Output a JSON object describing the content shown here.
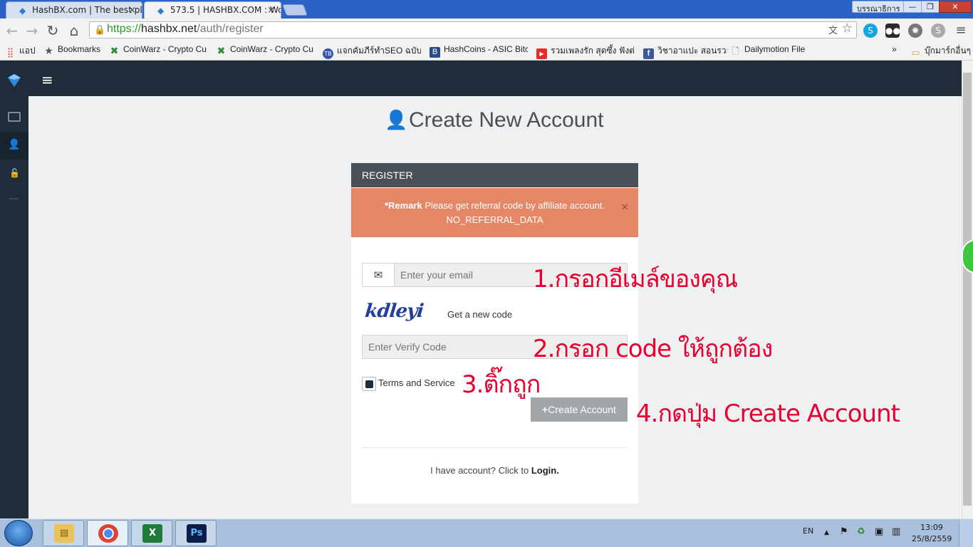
{
  "browser": {
    "tabs": [
      {
        "title": "HashBX.com | The best pl",
        "close": "×"
      },
      {
        "title": "573.5 | HASHBX.COM : Wo",
        "close": "×"
      }
    ],
    "profile_label": "บรรณาธิการ",
    "window_controls": {
      "minimize": "—",
      "restore": "❐",
      "close": "✕"
    },
    "url": {
      "scheme": "https://",
      "host": "hashbx.net",
      "path": "/auth/register"
    },
    "nav": {
      "back": "←",
      "forward": "→",
      "reload": "↻",
      "home": "⌂"
    },
    "star": "☆",
    "menu": "≡"
  },
  "bookmarks": {
    "items": [
      {
        "label": "แอป",
        "icon": "apps-grid-icon",
        "color": "#e04b3a"
      },
      {
        "label": "Bookmarks",
        "icon": "star-icon",
        "color": "#555555"
      },
      {
        "label": "CoinWarz - Crypto Cu",
        "icon": "coinwarz-icon",
        "color": "#2e8b3a"
      },
      {
        "label": "CoinWarz - Crypto Cu",
        "icon": "coinwarz-icon",
        "color": "#2e8b3a"
      },
      {
        "label": "แจกคัมภีร์ทำSEO ฉบับเต็",
        "icon": "seo-icon",
        "color": "#3657a8"
      },
      {
        "label": "HashCoins - ASIC Bitc",
        "icon": "hashcoins-icon",
        "color": "#2c4a85"
      },
      {
        "label": "รวมเพลงรัก สุดซึ้ง ฟังต่อเ",
        "icon": "youtube-icon",
        "color": "#e52d27"
      },
      {
        "label": "วิชาอาแปะ สอนรวย",
        "icon": "facebook-icon",
        "color": "#3b5998"
      },
      {
        "label": "Dailymotion File",
        "icon": "file-icon",
        "color": "#888888"
      }
    ],
    "overflow": "»",
    "other": "บุ๊กมาร์กอื่นๆ"
  },
  "app": {
    "menu_icon": "≡",
    "sidebar_icons": [
      "monitor-icon",
      "add-user-icon",
      "lock-icon"
    ]
  },
  "register": {
    "heading": "Create New Account",
    "panel_title": "REGISTER",
    "alert_strong": "*Remark",
    "alert_text": " Please get referral code by affiliate account.",
    "alert_code": "NO_REFERRAL_DATA",
    "alert_close": "×",
    "email_placeholder": "Enter your email",
    "captcha_text": "kdleyi",
    "new_code_label": "Get a new code",
    "verify_placeholder": "Enter Verify Code",
    "terms_label": "Terms and Service",
    "create_button": "Create Account",
    "create_button_icon": "+",
    "login_prompt": "I have account? Click to ",
    "login_link": "Login."
  },
  "annotations": [
    "1.กรอกอีเมล์ของคุณ",
    "2.กรอก  code  ให้ถูกต้อง",
    "3.ติ๊กถูก",
    "4.กดปุ่ม  Create  Account"
  ],
  "taskbar": {
    "language": "EN",
    "time": "13:09",
    "date": "25/8/2559"
  },
  "colors": {
    "sidebar": "#1f2d3a",
    "alert": "#e48767",
    "panel_head": "#4a5057",
    "annotation": "#e8002f",
    "button_disabled": "#a3a6a9"
  }
}
